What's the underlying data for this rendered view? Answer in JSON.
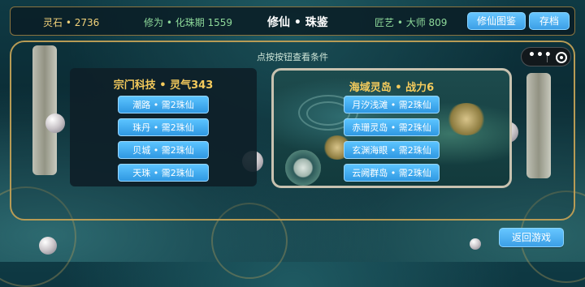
{
  "header": {
    "spirit_stone": "灵石 • 2736",
    "cultivation": "修为 • 化珠期 1559",
    "title": "修仙 • 珠鉴",
    "craft": "匠艺 • 大师 809",
    "atlas_button": "修仙图鉴",
    "save_button": "存档"
  },
  "hint": "点按按钮查看条件",
  "capsule": {
    "more_icon": "more-dots-icon",
    "close_icon": "target-circle-icon"
  },
  "sect_tech": {
    "title": "宗门科技 • 灵气343",
    "items": [
      "潮路 • 需2珠仙",
      "珠丹 • 需2珠仙",
      "贝城 • 需2珠仙",
      "天珠 • 需2珠仙"
    ]
  },
  "sea_islands": {
    "title": "海域灵岛 • 战力6",
    "items": [
      "月汐浅滩 • 需2珠仙",
      "赤珊灵岛 • 需2珠仙",
      "玄渊海眼 • 需2珠仙",
      "云阙群岛 • 需2珠仙"
    ]
  },
  "footer": {
    "return_button": "返回游戏"
  },
  "colors": {
    "accent_button": "#3c9fe6",
    "gold_title": "#f5cb5c",
    "green_text": "#8ed99a"
  }
}
